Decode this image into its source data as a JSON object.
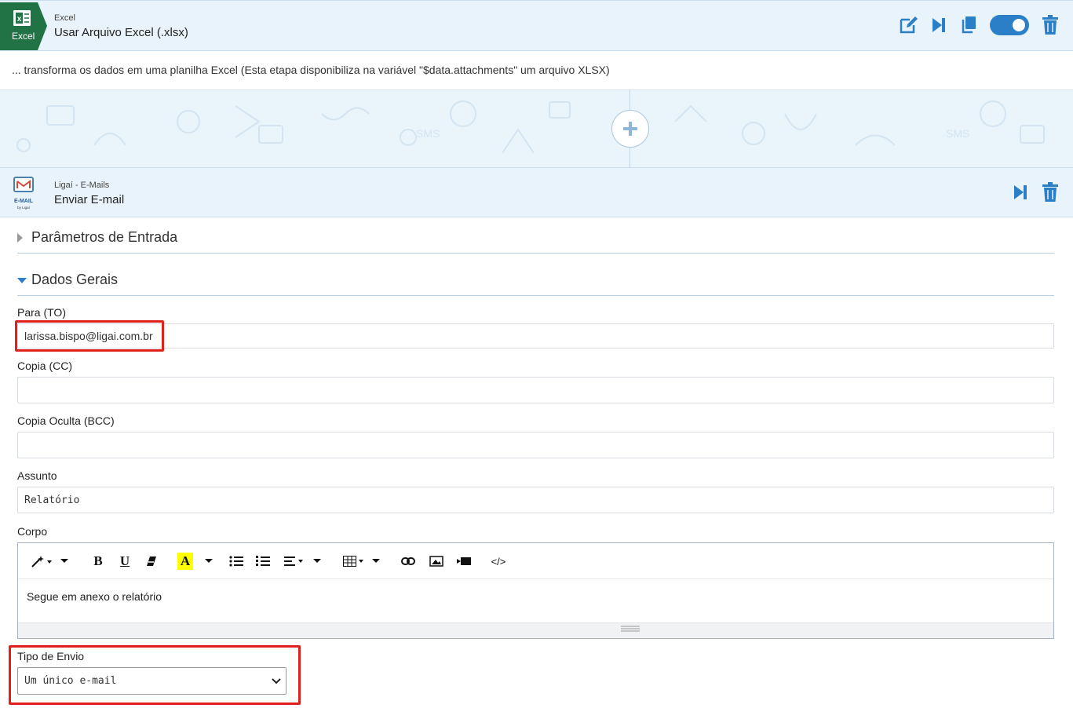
{
  "excel_step": {
    "badge_label": "Excel",
    "subtitle": "Excel",
    "title": "Usar Arquivo Excel (.xlsx)",
    "description": "... transforma os dados em uma planilha Excel (Esta etapa disponibiliza na variável \"$data.attachments\" um arquivo XLSX)",
    "icons": [
      "edit-icon",
      "skip-icon",
      "copy-icon",
      "toggle-switch",
      "trash-icon"
    ],
    "toggle_on": true
  },
  "email_step": {
    "logo_text": "E-MAIL",
    "logo_sub": "by Ligaí",
    "subtitle": "Ligaí - E-Mails",
    "title": "Enviar E-mail",
    "icons": [
      "skip-icon",
      "trash-icon"
    ]
  },
  "sections": {
    "input_params": "Parâmetros de Entrada",
    "general_data": "Dados Gerais"
  },
  "form": {
    "to_label": "Para (TO)",
    "to_value": "larissa.bispo@ligai.com.br",
    "cc_label": "Copia (CC)",
    "cc_value": "",
    "bcc_label": "Copia Oculta (BCC)",
    "bcc_value": "",
    "subject_label": "Assunto",
    "subject_value": "Relatório",
    "body_label": "Corpo",
    "body_value": "Segue em anexo o relatório",
    "send_type_label": "Tipo de Envio",
    "send_type_value": "Um único e-mail"
  },
  "toolbar_icons": [
    "magic-icon",
    "bold-icon",
    "underline-icon",
    "eraser-icon",
    "font-color-icon",
    "unordered-list-icon",
    "ordered-list-icon",
    "align-icon",
    "table-icon",
    "link-icon",
    "image-icon",
    "video-icon",
    "code-view-icon"
  ],
  "toolbar_glyphs": {
    "bold": "B",
    "underline": "U",
    "color": "A",
    "code": "</>"
  },
  "colors": {
    "accent": "#2b7fc7",
    "header_bg": "#e9f3fb",
    "highlight": "#e0201a",
    "excel_green": "#217346"
  }
}
